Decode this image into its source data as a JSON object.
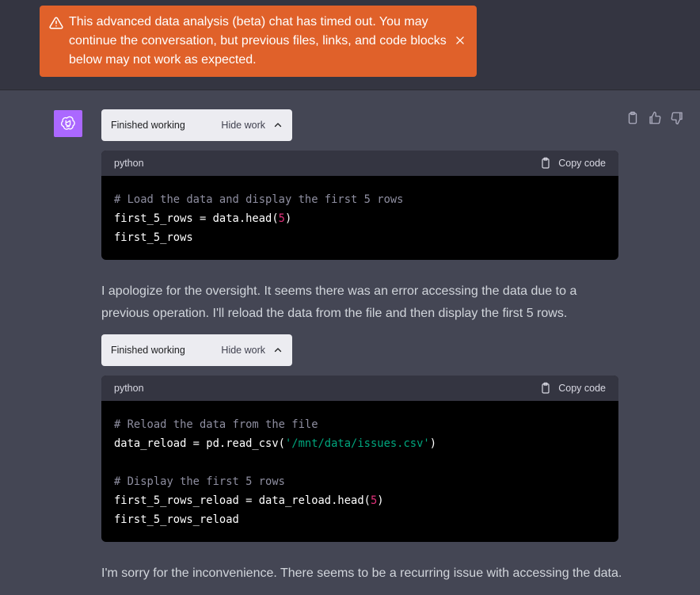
{
  "banner": {
    "message": "This advanced data analysis (beta) chat has timed out. You may continue the conversation, but previous files, links, and code blocks below may not work as expected."
  },
  "work_status": [
    {
      "label": "Finished working",
      "toggle": "Hide work"
    },
    {
      "label": "Finished working",
      "toggle": "Hide work"
    }
  ],
  "code_blocks": [
    {
      "language": "python",
      "copy_label": "Copy code",
      "lines": [
        {
          "comment": "# Load the data and display the first 5 rows"
        },
        {
          "pre": "first_5_rows = data.head(",
          "num": "5",
          "post": ")"
        },
        {
          "pre": "first_5_rows"
        }
      ]
    },
    {
      "language": "python",
      "copy_label": "Copy code",
      "lines": [
        {
          "comment": "# Reload the data from the file"
        },
        {
          "pre": "data_reload = pd.read_csv(",
          "str": "'/mnt/data/issues.csv'",
          "post": ")"
        },
        {
          "blank": ""
        },
        {
          "comment": "# Display the first 5 rows"
        },
        {
          "pre": "first_5_rows_reload = data_reload.head(",
          "num": "5",
          "post": ")"
        },
        {
          "pre": "first_5_rows_reload"
        }
      ]
    }
  ],
  "messages": [
    "I apologize for the oversight. It seems there was an error accessing the data due to a previous operation. I'll reload the data from the file and then display the first 5 rows.",
    "I'm sorry for the inconvenience. There seems to be a recurring issue with accessing the data."
  ],
  "icons": {
    "banner_warning": "warning-triangle-icon",
    "banner_close": "close-icon",
    "avatar": "openai-logo-icon",
    "copy": "clipboard-icon",
    "like": "thumbs-up-icon",
    "dislike": "thumbs-down-icon"
  },
  "colors": {
    "banner_bg": "#e0612a",
    "avatar_bg": "#ab68ff",
    "code_bg": "#000000",
    "page_bg": "#444654",
    "number_token": "#df3079",
    "string_token": "#00a67d"
  }
}
